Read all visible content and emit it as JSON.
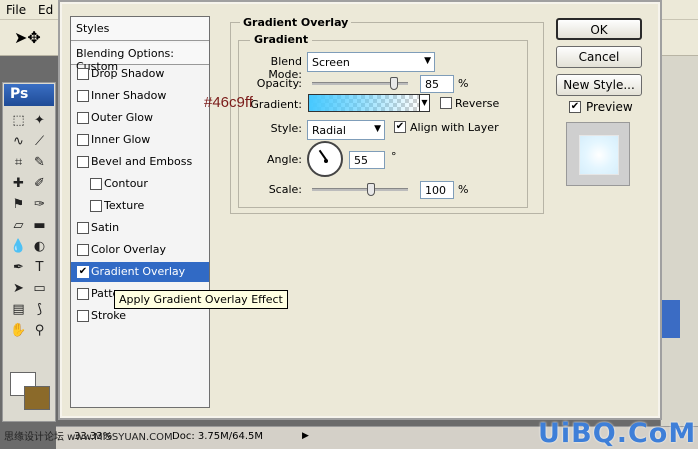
{
  "menubar": {
    "file": "File",
    "edit": "Ed"
  },
  "ps_badge": "Ps",
  "annotation_hex": "#46c9ff",
  "statusbar": {
    "zoom": "33.33%",
    "doc": "Doc: 3.75M/64.5M",
    "watermark_left": "思缘设计论坛 www.MISSYUAN.COM"
  },
  "watermark": "UiBQ.CoM",
  "colors": {
    "gradient_start": "#46c9ff",
    "selection": "#316ac5",
    "foreground": "#ffffff",
    "background": "#8b6a2a"
  },
  "styles_panel": {
    "header": "Styles",
    "blending": "Blending Options: Custom",
    "items": [
      {
        "label": "Drop Shadow",
        "checked": false,
        "selected": false,
        "indent": false
      },
      {
        "label": "Inner Shadow",
        "checked": false,
        "selected": false,
        "indent": false
      },
      {
        "label": "Outer Glow",
        "checked": false,
        "selected": false,
        "indent": false
      },
      {
        "label": "Inner Glow",
        "checked": false,
        "selected": false,
        "indent": false
      },
      {
        "label": "Bevel and Emboss",
        "checked": false,
        "selected": false,
        "indent": false
      },
      {
        "label": "Contour",
        "checked": false,
        "selected": false,
        "indent": true
      },
      {
        "label": "Texture",
        "checked": false,
        "selected": false,
        "indent": true
      },
      {
        "label": "Satin",
        "checked": false,
        "selected": false,
        "indent": false
      },
      {
        "label": "Color Overlay",
        "checked": false,
        "selected": false,
        "indent": false
      },
      {
        "label": "Gradient Overlay",
        "checked": true,
        "selected": true,
        "indent": false
      },
      {
        "label": "Patte",
        "checked": false,
        "selected": false,
        "indent": false
      },
      {
        "label": "Stroke",
        "checked": false,
        "selected": false,
        "indent": false
      }
    ]
  },
  "tooltip": "Apply Gradient Overlay Effect",
  "gradient_overlay": {
    "title": "Gradient Overlay",
    "subtitle": "Gradient",
    "blend_mode_label": "Blend Mode:",
    "blend_mode_value": "Screen",
    "opacity_label": "Opacity:",
    "opacity_value": "85",
    "opacity_unit": "%",
    "gradient_label": "Gradient:",
    "reverse_label": "Reverse",
    "style_label": "Style:",
    "style_value": "Radial",
    "align_label": "Align with Layer",
    "align_checked": true,
    "angle_label": "Angle:",
    "angle_value": "55",
    "angle_unit": "°",
    "scale_label": "Scale:",
    "scale_value": "100",
    "scale_unit": "%"
  },
  "buttons": {
    "ok": "OK",
    "cancel": "Cancel",
    "new_style": "New Style..."
  },
  "preview": {
    "label": "Preview",
    "checked": true
  }
}
